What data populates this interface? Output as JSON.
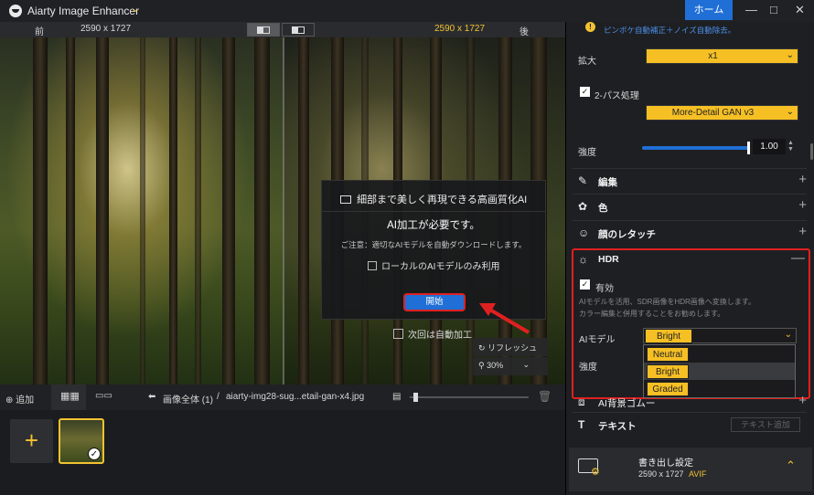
{
  "app": {
    "title": "Aiarty Image Enhancer",
    "home_label": "ホーム",
    "brand_color": "#f1c232",
    "accent": "#1f6fd6"
  },
  "compare": {
    "before_label": "前",
    "before_size": "2590 x 1727",
    "after_size": "2590 x 1727",
    "after_label": "後"
  },
  "dialog": {
    "title": "細部まで美しく再現できる高画質化AI",
    "need": "AI加工が必要です。",
    "note": "ご注意：適切なAIモデルを自動ダウンロードします。",
    "local_only": "ローカルのAIモデルのみ利用",
    "start": "開始"
  },
  "viewer": {
    "auto_process": "次回は自動加工",
    "refresh": "リフレッシュ",
    "zoom": "30%"
  },
  "bottombar": {
    "add": "追加",
    "breadcrumb_all": "画像全体 (1)",
    "separator": "/",
    "filename": "aiarty-img28-sug...etail-gan-x4.jpg"
  },
  "panel": {
    "tip": "ピンボケ自動補正＋ノイズ自動除去。",
    "scale_label": "拡大",
    "scale_value": "x1",
    "twopass_label": "2-パス処理",
    "model_value": "More-Detail GAN  v3",
    "strength_label": "強度",
    "strength_value": "1.00",
    "strength_level": 1.0,
    "sections": {
      "edit": "編集",
      "color": "色",
      "face": "顔のレタッチ",
      "hdr": "HDR",
      "bg": "AI背景ゴムー",
      "text": "テキスト"
    },
    "hdr": {
      "enabled_label": "有効",
      "desc1": "AIモデルを活用、SDR画像をHDR画像へ変換します。",
      "desc2": "カラー編集と併用することをお勧めします。",
      "model_label": "AIモデル",
      "model_value": "Bright",
      "strength_label": "強度",
      "options": [
        "Neutral",
        "Bright",
        "Graded"
      ]
    },
    "text_add": "テキスト追加",
    "export": {
      "title": "書き出し設定",
      "size": "2590 x 1727",
      "format": "AVIF"
    }
  }
}
